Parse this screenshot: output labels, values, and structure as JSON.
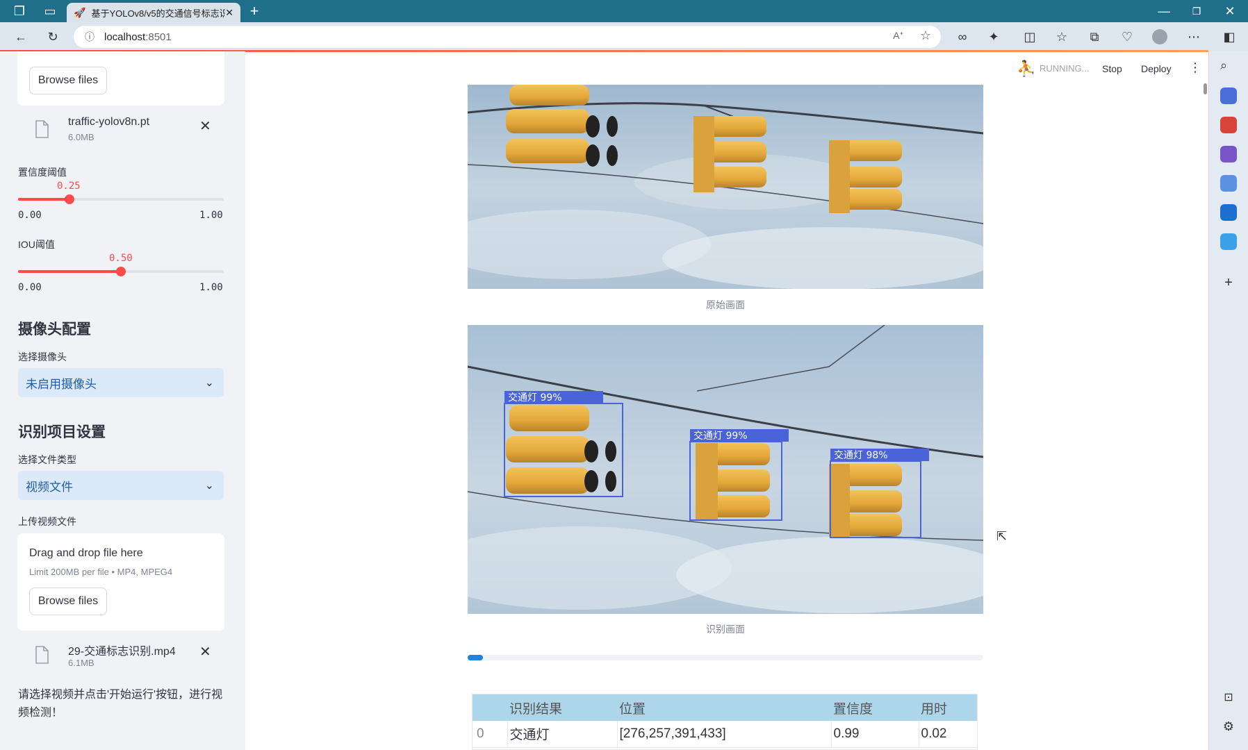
{
  "browser": {
    "tab_title": "基于YOLOv8/v5的交通信号标志识",
    "url_host": "localhost",
    "url_port": ":8501"
  },
  "header": {
    "status": "RUNNING...",
    "stop": "Stop",
    "deploy": "Deploy"
  },
  "sidebar": {
    "model_upload": {
      "browse": "Browse files",
      "file_name": "traffic-yolov8n.pt",
      "file_size": "6.0MB"
    },
    "confidence": {
      "label": "置信度阈值",
      "value": "0.25",
      "fraction": 0.25,
      "min": "0.00",
      "max": "1.00"
    },
    "iou": {
      "label": "IOU阈值",
      "value": "0.50",
      "fraction": 0.5,
      "min": "0.00",
      "max": "1.00"
    },
    "camera_section": "摄像头配置",
    "camera_label": "选择摄像头",
    "camera_value": "未启用摄像头",
    "recognition_section": "识别项目设置",
    "filetype_label": "选择文件类型",
    "filetype_value": "视频文件",
    "video_upload": {
      "label": "上传视频文件",
      "drag": "Drag and drop file here",
      "limit": "Limit 200MB per file • MP4, MPEG4",
      "browse": "Browse files",
      "file_name": "29-交通标志识别.mp4",
      "file_size": "6.1MB"
    },
    "hint": "请选择视频并点击'开始运行'按钮，进行视频检测！"
  },
  "main": {
    "original_caption": "原始画面",
    "detected_caption": "识别画面",
    "progress_fraction": 0.03,
    "detections": [
      {
        "label": "交通灯 99%"
      },
      {
        "label": "交通灯 99%"
      },
      {
        "label": "交通灯 98%"
      }
    ],
    "table": {
      "headers": [
        "识别结果",
        "位置",
        "置信度",
        "用时"
      ],
      "rows": [
        {
          "index": "0",
          "result": "交通灯",
          "position": "[276,257,391,433]",
          "confidence": "0.99",
          "time": "0.02"
        }
      ]
    }
  },
  "colors": {
    "accent": "#ff4b4b",
    "select_bg": "#dce9f8",
    "table_header": "#aed6ea",
    "bbox": "#4a63d8"
  }
}
